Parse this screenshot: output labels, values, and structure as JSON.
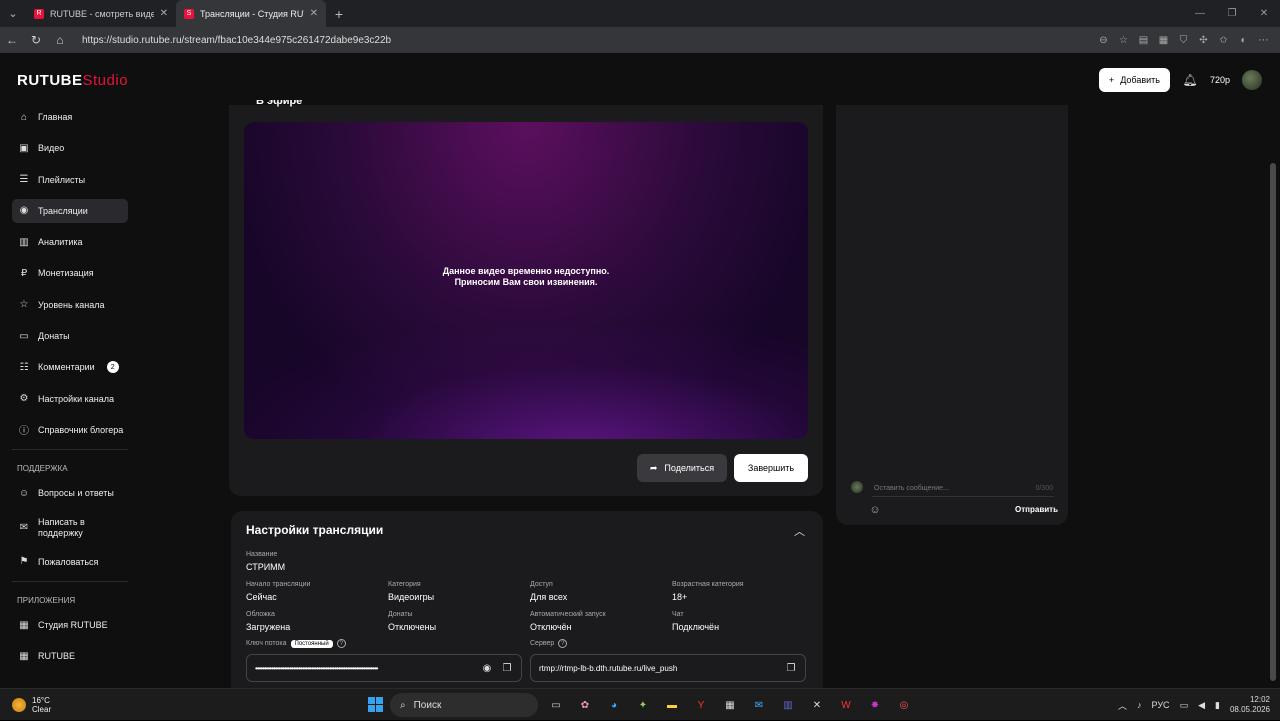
{
  "browser": {
    "tabs": [
      {
        "title": "RUTUBE - смотреть видео онлай",
        "fav": "R"
      },
      {
        "title": "Трансляции - Студия RUTUBE",
        "fav": "S"
      }
    ],
    "url": "https://studio.rutube.ru/stream/fbac10e344e975c261472dabe9e3c22b"
  },
  "header": {
    "logo_main": "RUTUBE",
    "logo_sub": "Studio",
    "add_label": "Добавить",
    "balance": "720р"
  },
  "sidebar": {
    "items": [
      {
        "label": "Главная",
        "icon": "home-icon",
        "glyph": "⌂"
      },
      {
        "label": "Видео",
        "icon": "video-icon",
        "glyph": "▣"
      },
      {
        "label": "Плейлисты",
        "icon": "playlist-icon",
        "glyph": "☰"
      },
      {
        "label": "Трансляции",
        "icon": "broadcast-icon",
        "glyph": "◉"
      },
      {
        "label": "Аналитика",
        "icon": "analytics-icon",
        "glyph": "▥"
      },
      {
        "label": "Монетизация",
        "icon": "monetization-icon",
        "glyph": "₽"
      },
      {
        "label": "Уровень канала",
        "icon": "star-icon",
        "glyph": "☆"
      },
      {
        "label": "Донаты",
        "icon": "donate-icon",
        "glyph": "▭"
      },
      {
        "label": "Комментарии",
        "icon": "comment-icon",
        "glyph": "☷",
        "badge": "2"
      },
      {
        "label": "Настройки канала",
        "icon": "gear-icon",
        "glyph": "⚙"
      },
      {
        "label": "Справочник блогера",
        "icon": "info-icon",
        "glyph": "ⓘ"
      }
    ],
    "support_title": "ПОДДЕРЖКА",
    "support_items": [
      {
        "label": "Вопросы и ответы",
        "icon": "faq-icon",
        "glyph": "☺"
      },
      {
        "label": "Написать в поддержку",
        "icon": "mail-icon",
        "glyph": "✉"
      },
      {
        "label": "Пожаловаться",
        "icon": "flag-icon",
        "glyph": "⚑"
      }
    ],
    "apps_title": "ПРИЛОЖЕНИЯ",
    "app_items": [
      {
        "label": "Студия RUTUBE",
        "icon": "studio-app-icon",
        "glyph": "▦"
      },
      {
        "label": "RUTUBE",
        "icon": "rutube-app-icon",
        "glyph": "▦"
      }
    ]
  },
  "player": {
    "onair": "В эфире",
    "message_line1": "Данное видео временно недоступно.",
    "message_line2": "Приносим Вам свои извинения.",
    "share_label": "Поделиться",
    "end_label": "Завершить"
  },
  "chat": {
    "placeholder": "Оставить сообщение...",
    "counter": "0/300",
    "send_label": "Отправить"
  },
  "settings": {
    "title": "Настройки трансляции",
    "name_label": "Название",
    "name_value": "СТРИММ",
    "fields": [
      {
        "label": "Начало трансляции",
        "value": "Сейчас"
      },
      {
        "label": "Категория",
        "value": "Видеоигры"
      },
      {
        "label": "Доступ",
        "value": "Для всех"
      },
      {
        "label": "Возрастная категория",
        "value": "18+"
      },
      {
        "label": "Обложка",
        "value": "Загружена"
      },
      {
        "label": "Донаты",
        "value": "Отключены"
      },
      {
        "label": "Автоматический запуск",
        "value": "Отключён"
      },
      {
        "label": "Чат",
        "value": "Подключён"
      }
    ],
    "key_label": "Ключ потока",
    "key_pill": "Постоянный",
    "key_dots": "••••••••••••••••••••••••••••••••••••••••••••••••••••••••••••••••••••",
    "server_label": "Сервер",
    "server_value": "rtmp://rtmp-lb-b.dth.rutube.ru/live_push"
  },
  "taskbar": {
    "temp": "16°C",
    "condition": "Clear",
    "search": "Поиск",
    "lang": "РУС",
    "time": "12:02",
    "date": "08.05.2026"
  }
}
